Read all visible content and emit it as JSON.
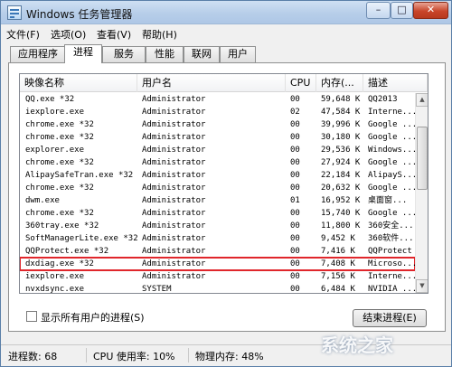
{
  "window": {
    "title": "Windows 任务管理器",
    "minimize": "–",
    "maximize": "□",
    "close": "✕"
  },
  "menu": [
    "文件(F)",
    "选项(O)",
    "查看(V)",
    "帮助(H)"
  ],
  "tabs": [
    "应用程序",
    "进程",
    "服务",
    "性能",
    "联网",
    "用户"
  ],
  "active_tab": "进程",
  "columns": [
    "映像名称",
    "用户名",
    "CPU",
    "内存(...",
    "描述"
  ],
  "rows": [
    {
      "name": "QQ.exe *32",
      "user": "Administrator",
      "cpu": "00",
      "mem": "59,648 K",
      "desc": "QQ2013"
    },
    {
      "name": "iexplore.exe",
      "user": "Administrator",
      "cpu": "02",
      "mem": "47,584 K",
      "desc": "Interne..."
    },
    {
      "name": "chrome.exe *32",
      "user": "Administrator",
      "cpu": "00",
      "mem": "39,996 K",
      "desc": "Google ..."
    },
    {
      "name": "chrome.exe *32",
      "user": "Administrator",
      "cpu": "00",
      "mem": "30,180 K",
      "desc": "Google ..."
    },
    {
      "name": "explorer.exe",
      "user": "Administrator",
      "cpu": "00",
      "mem": "29,536 K",
      "desc": "Windows..."
    },
    {
      "name": "chrome.exe *32",
      "user": "Administrator",
      "cpu": "00",
      "mem": "27,924 K",
      "desc": "Google ..."
    },
    {
      "name": "AlipaySafeTran.exe *32",
      "user": "Administrator",
      "cpu": "00",
      "mem": "22,184 K",
      "desc": "AlipayS..."
    },
    {
      "name": "chrome.exe *32",
      "user": "Administrator",
      "cpu": "00",
      "mem": "20,632 K",
      "desc": "Google ..."
    },
    {
      "name": "dwm.exe",
      "user": "Administrator",
      "cpu": "01",
      "mem": "16,952 K",
      "desc": "桌面窗..."
    },
    {
      "name": "chrome.exe *32",
      "user": "Administrator",
      "cpu": "00",
      "mem": "15,740 K",
      "desc": "Google ..."
    },
    {
      "name": "360tray.exe *32",
      "user": "Administrator",
      "cpu": "00",
      "mem": "11,800 K",
      "desc": "360安全..."
    },
    {
      "name": "SoftManagerLite.exe *32",
      "user": "Administrator",
      "cpu": "00",
      "mem": "9,452 K",
      "desc": "360软件..."
    },
    {
      "name": "QQProtect.exe *32",
      "user": "Administrator",
      "cpu": "00",
      "mem": "7,416 K",
      "desc": "QQProtect"
    },
    {
      "name": "dxdiag.exe *32",
      "user": "Administrator",
      "cpu": "00",
      "mem": "7,408 K",
      "desc": "Microso..."
    },
    {
      "name": "iexplore.exe",
      "user": "Administrator",
      "cpu": "00",
      "mem": "7,156 K",
      "desc": "Interne..."
    },
    {
      "name": "nvxdsync.exe",
      "user": "SYSTEM",
      "cpu": "00",
      "mem": "6,484 K",
      "desc": "NVIDIA ..."
    }
  ],
  "selected_row": 13,
  "show_all_label": "显示所有用户的进程(S)",
  "end_process_label": "结束进程(E)",
  "status": {
    "processes": "进程数: 68",
    "cpu": "CPU 使用率: 10%",
    "memory": "物理内存: 48%"
  },
  "watermark": "系统之家",
  "colors": {
    "highlight_border": "#e0262b",
    "title_gradient": "#b7cee9"
  }
}
